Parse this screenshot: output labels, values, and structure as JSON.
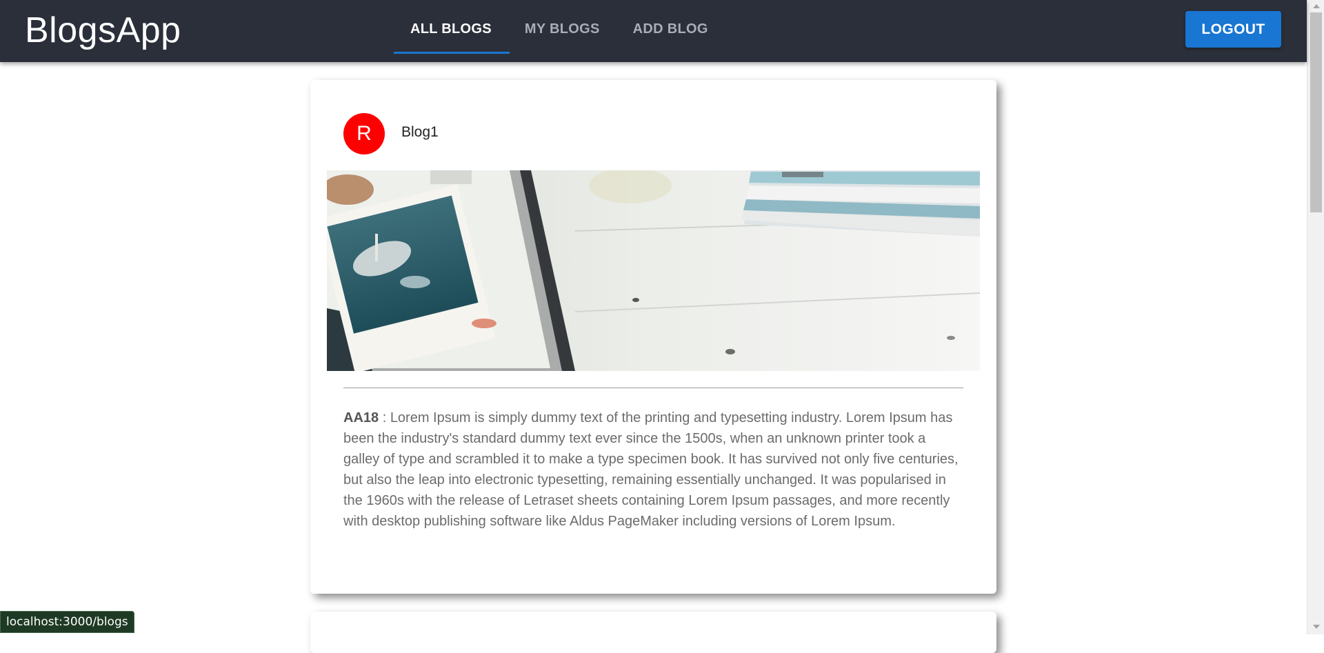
{
  "app": {
    "title": "BlogsApp"
  },
  "nav": {
    "tabs": [
      {
        "label": "ALL BLOGS",
        "active": true
      },
      {
        "label": "MY BLOGS",
        "active": false
      },
      {
        "label": "ADD BLOG",
        "active": false
      }
    ],
    "logout_label": "LOGOUT"
  },
  "blog": {
    "avatar_letter": "R",
    "title": "Blog1",
    "code": "AA18",
    "separator": " : ",
    "description": "Lorem Ipsum is simply dummy text of the printing and typesetting industry. Lorem Ipsum has been the industry's standard dummy text ever since the 1500s, when an unknown printer took a galley of type and scrambled it to make a type specimen book. It has survived not only five centuries, but also the leap into electronic typesetting, remaining essentially unchanged. It was popularised in the 1960s with the release of Letraset sheets containing Lorem Ipsum passages, and more recently with desktop publishing software like Aldus PageMaker including versions of Lorem Ipsum."
  },
  "status_bar": {
    "url": "localhost:3000/blogs"
  },
  "colors": {
    "appbar": "#2b2f3a",
    "accent": "#1976d2",
    "avatar": "#ff0000"
  }
}
